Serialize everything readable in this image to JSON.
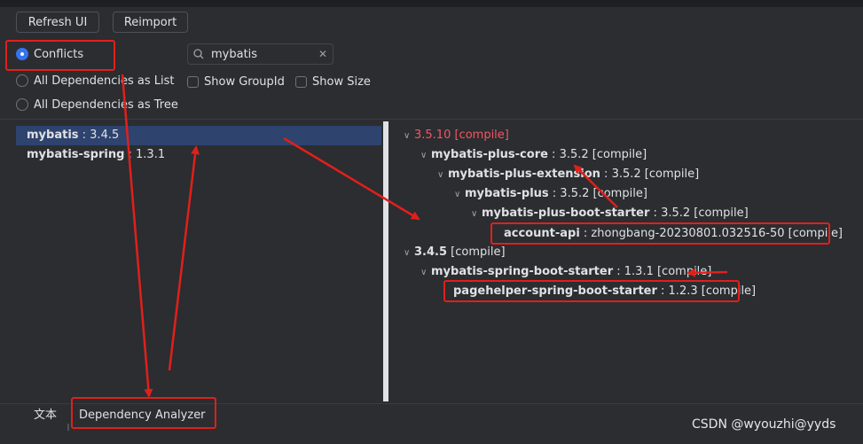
{
  "toolbar": {
    "refresh": "Refresh UI",
    "reimport": "Reimport"
  },
  "modes": {
    "conflicts": "Conflicts",
    "as_list": "All Dependencies as List",
    "as_tree": "All Dependencies as Tree",
    "selected": "Conflicts"
  },
  "search": {
    "value": "mybatis"
  },
  "options": {
    "show_groupid": "Show GroupId",
    "show_size": "Show Size"
  },
  "left_list": [
    {
      "name": "mybatis",
      "version": " : 3.4.5"
    },
    {
      "name": "mybatis-spring",
      "version": " : 1.3.1"
    }
  ],
  "tree": {
    "n0": {
      "label": "3.5.10 [compile]"
    },
    "n1": {
      "name": "mybatis-plus-core",
      "rest": " : 3.5.2 [compile]"
    },
    "n2": {
      "name": "mybatis-plus-extension",
      "rest": " : 3.5.2 [compile]"
    },
    "n3": {
      "name": "mybatis-plus",
      "rest": " : 3.5.2 [compile]"
    },
    "n4": {
      "name": "mybatis-plus-boot-starter",
      "rest": " : 3.5.2 [compile]"
    },
    "n5": {
      "name": "account-api",
      "rest": " : zhongbang-20230801.032516-50 [compile]"
    },
    "n6": {
      "name": "3.4.5",
      "rest": " [compile]"
    },
    "n7": {
      "name": "mybatis-spring-boot-starter",
      "rest": " : 1.3.1 [compile]"
    },
    "n8": {
      "name": "pagehelper-spring-boot-starter",
      "rest": " : 1.2.3 [compile]"
    }
  },
  "bottom_tabs": {
    "text_tab": "文本",
    "analyzer_tab": "Dependency Analyzer"
  },
  "watermark": "CSDN @wyouzhi@yyds",
  "colors": {
    "accent": "#3574f0",
    "conflict": "#f75464",
    "annotation": "#e0201b",
    "selection": "#2e436e"
  }
}
